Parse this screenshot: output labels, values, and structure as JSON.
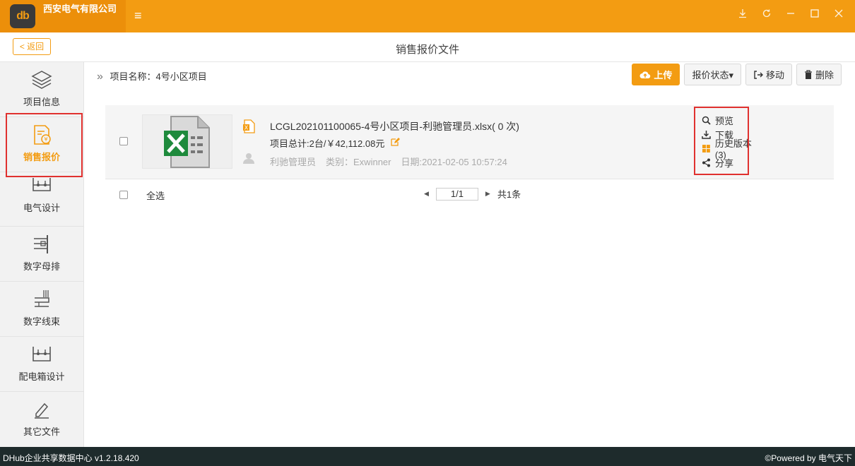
{
  "app": {
    "brand_name": "西安电气有限公司",
    "logo_text": "db",
    "menu_icon": "hamburger-icon",
    "window_buttons": [
      "download-icon",
      "refresh-icon",
      "minimize-icon",
      "maximize-icon",
      "close-icon"
    ]
  },
  "header": {
    "back_label": "< 返回",
    "page_title": "销售报价文件"
  },
  "sidebar": {
    "items": [
      {
        "label": "项目信息",
        "icon": "layers-icon"
      },
      {
        "label": "销售报价",
        "icon": "quote-document-icon",
        "active": true
      },
      {
        "label": "电气设计",
        "icon": "electrical-design-icon"
      },
      {
        "label": "数字母排",
        "icon": "busbar-icon"
      },
      {
        "label": "数字线束",
        "icon": "wire-harness-icon"
      },
      {
        "label": "配电箱设计",
        "icon": "distribution-box-icon"
      },
      {
        "label": "其它文件",
        "icon": "pencil-icon"
      }
    ]
  },
  "main": {
    "breadcrumb": "项目名称：4号小区项目",
    "toolbar": {
      "upload": "上传",
      "status": "报价状态▾",
      "move": "移动",
      "delete": "删除"
    },
    "file": {
      "name": "LCGL202101100065-4号小区项目-利驰管理员.xlsx( 0 次)",
      "total": "项目总计:2台/￥42,112.08元",
      "owner": "利驰管理员",
      "category": "类别：Exwinner",
      "date": "日期:2021-02-05 10:57:24",
      "actions": {
        "preview": "预览",
        "download": "下载",
        "history": "历史版本(3)",
        "share": "分享"
      }
    },
    "list_footer": {
      "select_all": "全选",
      "page": "1/1",
      "total": "共1条"
    }
  },
  "statusbar": {
    "left": "DHub企业共享数据中心 v1.2.18.420",
    "right": "©Powered by 电气天下"
  },
  "colors": {
    "accent": "#f39c12",
    "highlight": "#e0312f",
    "statusbar": "#1e2b2c",
    "excel_green": "#1e8a3c"
  }
}
